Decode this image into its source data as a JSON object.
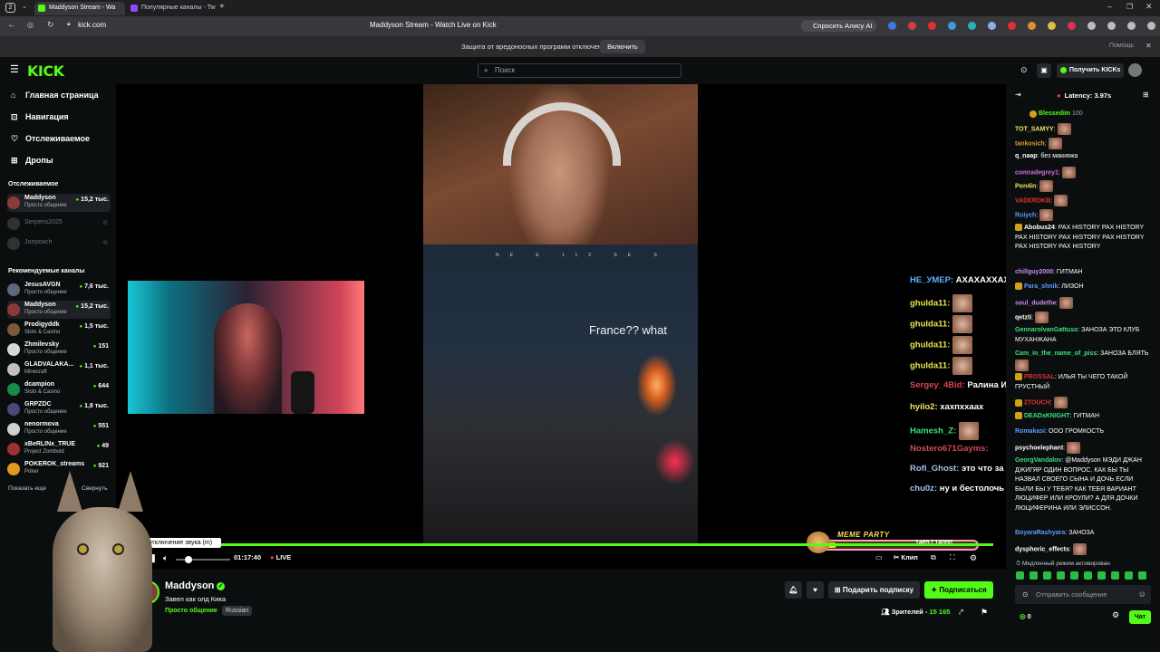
{
  "browser": {
    "tabs": [
      {
        "label": "Maddyson Stream - Wa"
      },
      {
        "label": "Популярные каналы - Tw"
      }
    ],
    "url": "kick.com",
    "page_title": "Maddyson Stream - Watch Live on Kick",
    "alice_label": "Спросить Алису AI",
    "notice_text": "Защита от вредоносных программ отключена",
    "notice_button": "Включить",
    "notice_help": "Помощь",
    "tab_count": "2"
  },
  "header": {
    "logo": "KICK",
    "search_placeholder": "Поиск",
    "get_kicks": "Получить KICKs"
  },
  "sidebar": {
    "nav": [
      {
        "label": "Главная страница",
        "icon": "home-icon"
      },
      {
        "label": "Навигация",
        "icon": "compass-icon"
      },
      {
        "label": "Отслеживаемое",
        "icon": "heart-icon"
      },
      {
        "label": "Дропы",
        "icon": "gift-icon"
      }
    ],
    "followed_title": "Отслеживаемое",
    "followed": [
      {
        "name": "Maddyson",
        "category": "Просто общение",
        "viewers": "15,2 тыс.",
        "live": true
      },
      {
        "name": "Serpens2025",
        "category": "",
        "viewers": "",
        "live": false
      },
      {
        "name": "Joepeach",
        "category": "",
        "viewers": "",
        "live": false
      }
    ],
    "recommended_title": "Рекомендуемые каналы",
    "recommended": [
      {
        "name": "JesusAVGN",
        "category": "Просто общение",
        "viewers": "7,6 тыс."
      },
      {
        "name": "Maddyson",
        "category": "Просто общение",
        "viewers": "15,2 тыс."
      },
      {
        "name": "Prodigyddk",
        "category": "Slots & Casino",
        "viewers": "1,5 тыс."
      },
      {
        "name": "Zhmilevsky",
        "category": "Просто общение",
        "viewers": "151"
      },
      {
        "name": "GLADVALAKA...",
        "category": "Minecraft",
        "viewers": "1,1 тыс."
      },
      {
        "name": "dcampion",
        "category": "Slots & Casino",
        "viewers": "644"
      },
      {
        "name": "GRPZDC",
        "category": "Просто общение",
        "viewers": "1,8 тыс."
      },
      {
        "name": "nenormova",
        "category": "Просто общение",
        "viewers": "551"
      },
      {
        "name": "xBeRLINx_TRUE",
        "category": "Project Zomboid",
        "viewers": "49"
      },
      {
        "name": "POKEROK_streams",
        "category": "Poker",
        "viewers": "921"
      }
    ],
    "show_more": "Показать еще",
    "collapse": "Свернуть"
  },
  "player": {
    "game_caption": "France?? what",
    "tooltip": "ть отключение звука (m)",
    "time": "01:17:40",
    "live": "LIVE",
    "clip_label": "Клип",
    "overlay_chat": [
      {
        "user": "HE_УМЕР",
        "msg": "АХАХАХХАХА",
        "color": "#5fb0ff",
        "emote": false
      },
      {
        "user": "ghulda11",
        "msg": "",
        "color": "#e8e84a",
        "emote": true
      },
      {
        "user": "ghulda11",
        "msg": "",
        "color": "#e8e84a",
        "emote": true
      },
      {
        "user": "ghulda11",
        "msg": "",
        "color": "#e8e84a",
        "emote": true
      },
      {
        "user": "ghulda11",
        "msg": "",
        "color": "#e8e84a",
        "emote": true
      },
      {
        "user": "Sergey_4Bid",
        "msg": "Ралина Ин похорошела",
        "color": "#d6455a",
        "emote": false
      },
      {
        "user": "hyilo2",
        "msg": "хахпххаах",
        "color": "#f5e663",
        "emote": false
      },
      {
        "user": "Hamesh_Z",
        "msg": "",
        "color": "#3ce07a",
        "emote": true
      },
      {
        "user": "Nostero671Gayms",
        "msg": "",
        "color": "#d04a5a",
        "emote": false
      },
      {
        "user": "Rofl_Ghost",
        "msg": "это что за фрик",
        "color": "#9dc2e8",
        "emote": false
      },
      {
        "user": "chu0z",
        "msg": "ну и бестолочь",
        "color": "#9dc2e8",
        "emote": false
      }
    ],
    "meme_party": {
      "title": "MEME PARTY",
      "count": "1465 / 14000",
      "progress": 0.1
    }
  },
  "stream": {
    "name": "Maddyson",
    "title": "Завел как олд Кика",
    "category": "Просто общение",
    "language": "Russian",
    "gift_sub": "Подарить подписку",
    "subscribe": "Подписаться",
    "viewers_label": "Зрителей -",
    "viewers": "15 165"
  },
  "chat": {
    "latency": "Latency: 3.97s",
    "pinned_user": "Blessedim",
    "pinned_count": "100",
    "messages": [
      {
        "user": "TOT_SAMYY",
        "color": "#f5e663",
        "text": "",
        "emote": 1,
        "badge": false
      },
      {
        "user": "tankosich",
        "color": "#e0962e",
        "text": "",
        "emote": 1,
        "badge": false
      },
      {
        "user": "q_naap",
        "color": "#ffffff",
        "text": "без макияжа",
        "emote": 0,
        "badge": false
      },
      {
        "user": "comradegrey1",
        "color": "#d46fe0",
        "text": "",
        "emote": 1,
        "badge": false
      },
      {
        "user": "Pon4in",
        "color": "#f5e663",
        "text": "",
        "emote": 1,
        "badge": false
      },
      {
        "user": "VADERDKB",
        "color": "#e03030",
        "text": "",
        "emote": 1,
        "badge": false
      },
      {
        "user": "Ruiych",
        "color": "#5a9bff",
        "text": "",
        "emote": 1,
        "badge": false
      },
      {
        "user": "Abobus24",
        "color": "#ffffff",
        "text": "PAX HISTORY PAX HISTORY PAX HISTORY PAX HISTORY PAX HISTORY PAX HISTORY PAX HISTORY",
        "emote": 0,
        "badge": true
      },
      {
        "user": "chillguy2000",
        "color": "#c88cf0",
        "text": "ГИТМАН",
        "emote": 0,
        "badge": false
      },
      {
        "user": "Para_shnik",
        "color": "#5a9bff",
        "text": "ЛИЗОН",
        "emote": 0,
        "badge": true
      },
      {
        "user": "soul_dudethe",
        "color": "#c88cf0",
        "text": "",
        "emote": 1,
        "badge": false
      },
      {
        "user": "qetzti",
        "color": "#ffffff",
        "text": "",
        "emote": 1,
        "badge": false
      },
      {
        "user": "GennarolvanGattuso",
        "color": "#3ce07a",
        "text": "ЗАНОЗА ЭТО КЛУБ МУХАНЖАНА",
        "emote": 0,
        "badge": false
      },
      {
        "user": "Cam_in_the_name_of_piss",
        "color": "#3ce07a",
        "text": "ЗАНОЗА БЛЯТЬ",
        "emote": 1,
        "badge": false
      },
      {
        "user": "PROSSAL",
        "color": "#e03030",
        "text": "ИЛЬЯ ТЫ ЧЕГО ТАКОЙ ГРУСТНЫЙ",
        "emote": 0,
        "badge": true
      },
      {
        "user": "2TOUCH",
        "color": "#e03030",
        "text": "",
        "emote": 1,
        "badge": true
      },
      {
        "user": "DEADxKNIGHT",
        "color": "#3ce07a",
        "text": "ГИТМАН",
        "emote": 0,
        "badge": true
      },
      {
        "user": "Romakasi",
        "color": "#5a9bff",
        "text": "ООО ГРОМКОСТЬ",
        "emote": 0,
        "badge": false
      },
      {
        "user": "psychoelephant",
        "color": "#ffffff",
        "text": "",
        "emote": 1,
        "badge": false
      },
      {
        "user": "GeorgVandalov",
        "color": "#3ce07a",
        "text": "@Maddyson МЭДИ ДЖАН ДЖИГЯР ОДИН ВОПРОС. КАК БЫ ТЫ НАЗВАЛ СВОЕГО СЫНА И ДОЧЬ ЕСЛИ БЫЛИ БЫ У ТЕБЯ? КАК ТЕБЯ ВАРИАНТ ЛЮЦИФЕР ИЛИ КРОУЛИ? А ДЛЯ ДОЧКИ ЛЮЦИФЕРИНА ИЛИ ЭЛИССОН.",
        "emote": 0,
        "badge": false
      },
      {
        "user": "BoyaraRashyara",
        "color": "#5a9bff",
        "text": "ЗАНОЗА",
        "emote": 0,
        "badge": false
      },
      {
        "user": "dysphoric_effects",
        "color": "#ffffff",
        "text": "",
        "emote": 1,
        "badge": false
      }
    ],
    "slow_mode": "Медленный режим активирован",
    "input_placeholder": "Отправить сообщение",
    "points": "0",
    "send_label": "Чат"
  }
}
